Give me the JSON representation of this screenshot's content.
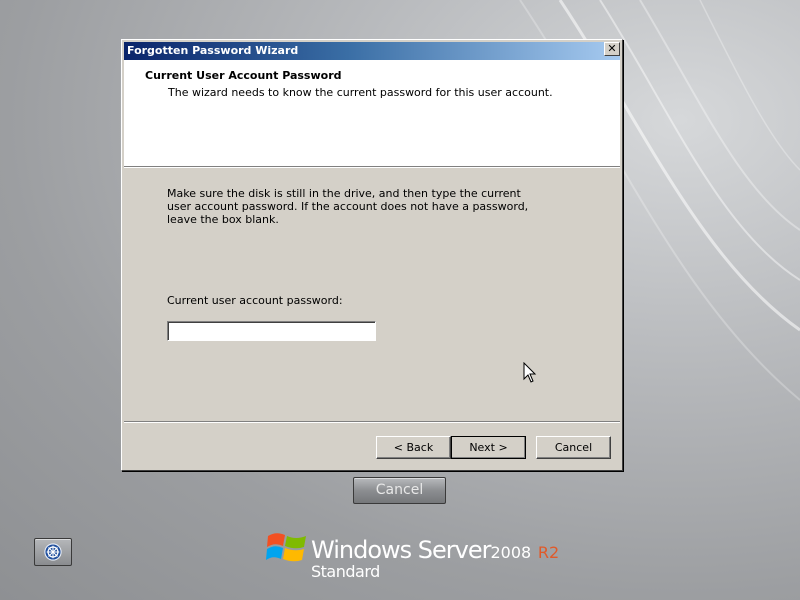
{
  "dialog": {
    "title": "Forgotten Password Wizard",
    "close_glyph": "✕",
    "header": {
      "title": "Current User Account Password",
      "subtitle": "The wizard needs to know the current password for this user account."
    },
    "instructions": "Make sure the disk is still in the drive, and then type the current user account password. If the account does not have a password, leave the box blank.",
    "password_label": "Current user account password:",
    "password_value": "",
    "buttons": {
      "back": "< Back",
      "next": "Next >",
      "cancel": "Cancel"
    }
  },
  "desktop": {
    "cancel_button": "Cancel",
    "accessibility_icon": "ease-of-access-icon",
    "branding": {
      "product": "Windows Server",
      "year": "2008",
      "release": "R2",
      "edition": "Standard",
      "logo_icon": "windows-flag-icon"
    }
  },
  "colors": {
    "title_bar_start": "#0a246a",
    "title_bar_end": "#a6caf0",
    "dialog_face": "#d4d0c8",
    "release_accent": "#e05a2a"
  }
}
